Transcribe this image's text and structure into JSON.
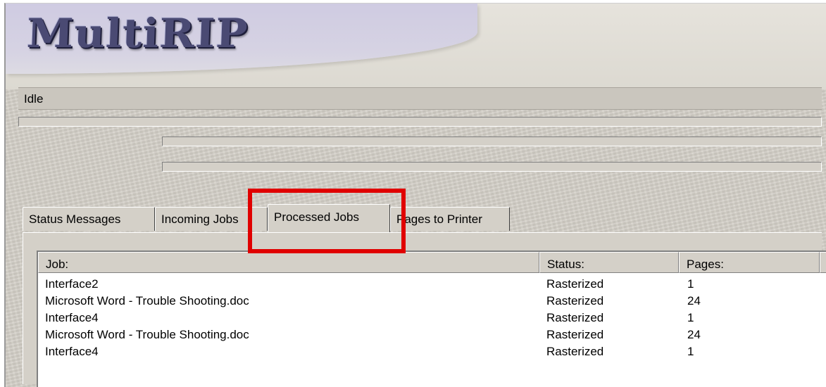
{
  "app": {
    "logo_text": "MultiRIP"
  },
  "status": {
    "text": "Idle"
  },
  "tabs": [
    {
      "label": "Status Messages"
    },
    {
      "label": "Incoming Jobs"
    },
    {
      "label": "Processed Jobs",
      "selected": true
    },
    {
      "label": "Pages to Printer"
    }
  ],
  "table": {
    "headers": {
      "job": "Job:",
      "status": "Status:",
      "pages": "Pages:"
    },
    "rows": [
      {
        "job": "Interface2",
        "status": "Rasterized",
        "pages": "1"
      },
      {
        "job": "Microsoft Word - Trouble Shooting.doc",
        "status": "Rasterized",
        "pages": "24"
      },
      {
        "job": "Interface4",
        "status": "Rasterized",
        "pages": "1"
      },
      {
        "job": "Microsoft Word - Trouble Shooting.doc",
        "status": "Rasterized",
        "pages": "24"
      },
      {
        "job": "Interface4",
        "status": "Rasterized",
        "pages": "1"
      }
    ]
  },
  "colors": {
    "highlight": "#e00000",
    "face": "#d4d0c8"
  }
}
